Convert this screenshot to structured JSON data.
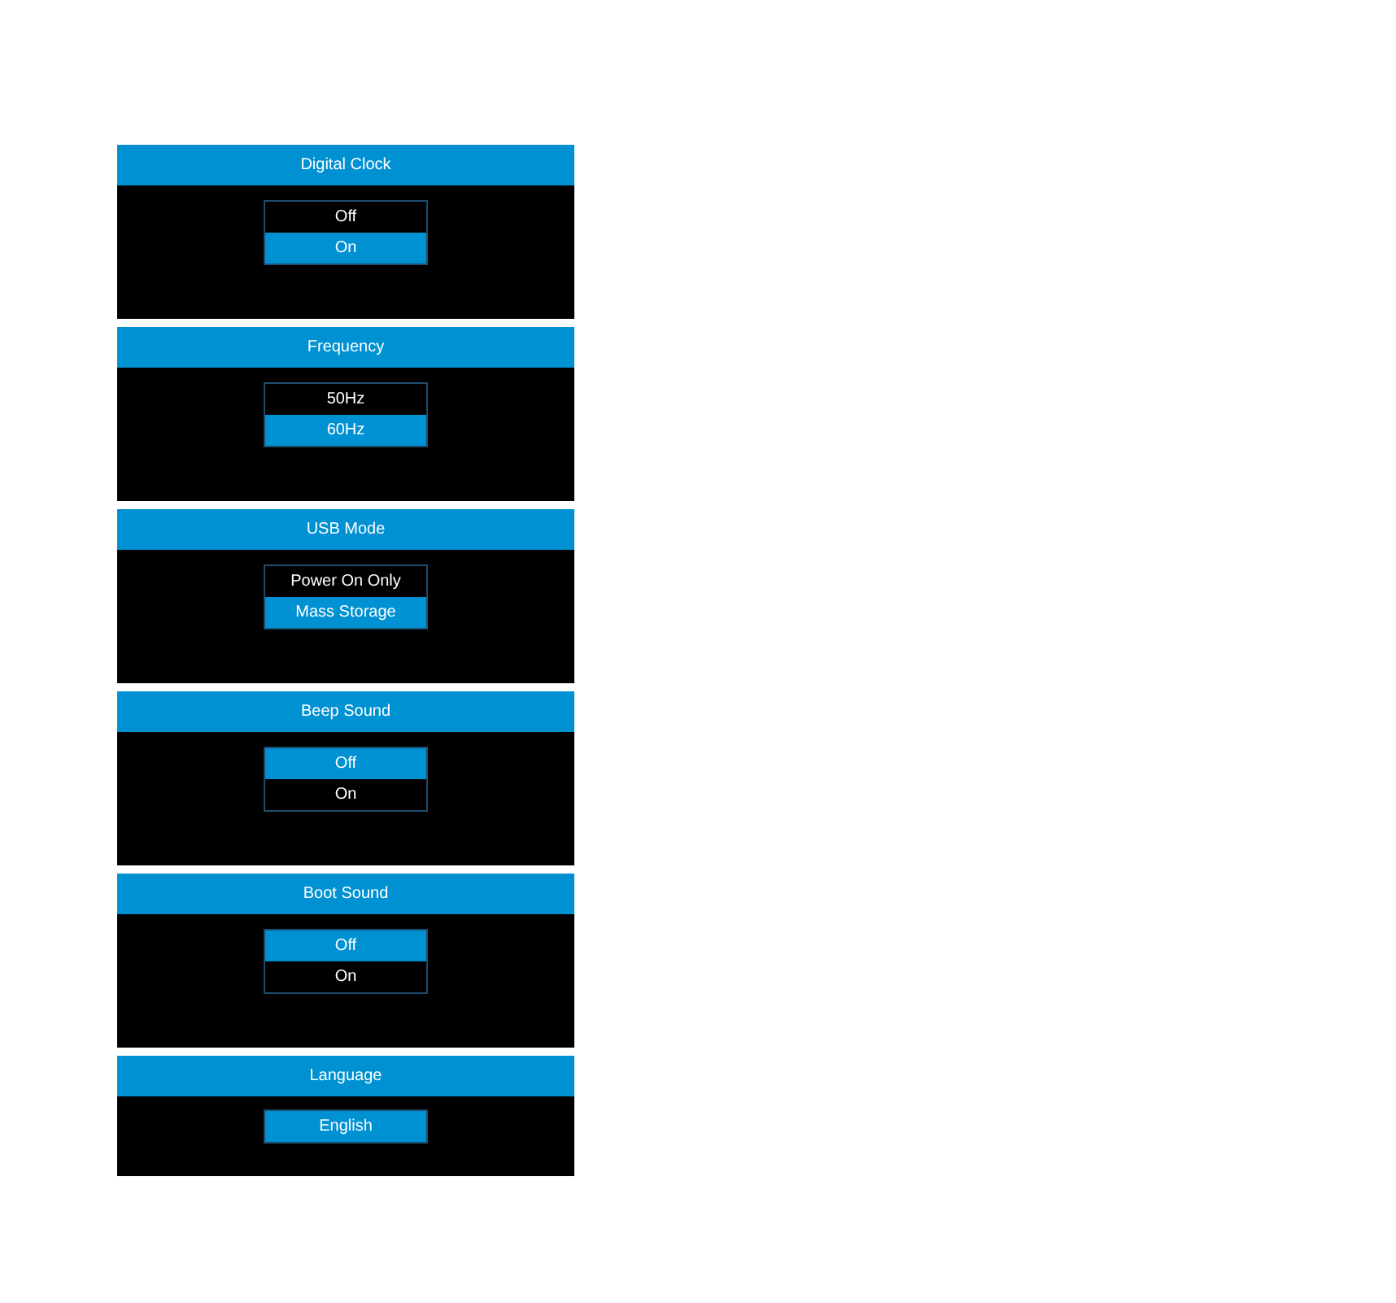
{
  "panels": [
    {
      "title": "Digital Clock",
      "options": [
        {
          "label": "Off",
          "selected": false
        },
        {
          "label": "On",
          "selected": true
        }
      ]
    },
    {
      "title": "Frequency",
      "options": [
        {
          "label": "50Hz",
          "selected": false
        },
        {
          "label": "60Hz",
          "selected": true
        }
      ]
    },
    {
      "title": "USB Mode",
      "options": [
        {
          "label": "Power On Only",
          "selected": false
        },
        {
          "label": "Mass Storage",
          "selected": true
        }
      ]
    },
    {
      "title": "Beep Sound",
      "options": [
        {
          "label": "Off",
          "selected": true
        },
        {
          "label": "On",
          "selected": false
        }
      ]
    },
    {
      "title": "Boot Sound",
      "options": [
        {
          "label": "Off",
          "selected": true
        },
        {
          "label": "On",
          "selected": false
        }
      ]
    },
    {
      "title": "Language",
      "options": [
        {
          "label": "English",
          "selected": true
        }
      ]
    }
  ]
}
